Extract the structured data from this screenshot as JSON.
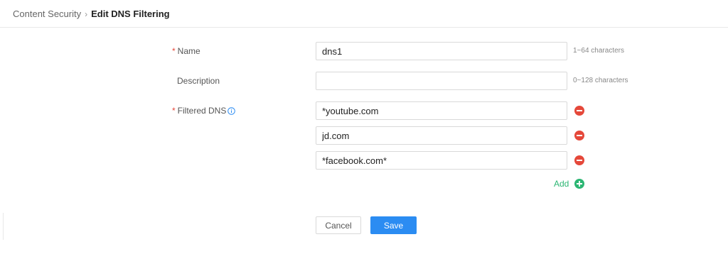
{
  "breadcrumb": {
    "parent": "Content Security",
    "separator": "›",
    "current": "Edit DNS Filtering"
  },
  "form": {
    "name": {
      "label": "Name",
      "required_mark": "*",
      "value": "dns1",
      "hint": "1~64 characters"
    },
    "description": {
      "label": "Description",
      "value": "",
      "hint": "0~128 characters"
    },
    "filtered_dns": {
      "label": "Filtered DNS",
      "required_mark": "*",
      "info_icon": "info-circle-icon",
      "entries": [
        "*youtube.com",
        "jd.com",
        "*facebook.com*"
      ],
      "remove_icon": "remove-circle-icon",
      "add_label": "Add",
      "add_icon": "add-circle-icon"
    }
  },
  "actions": {
    "cancel_label": "Cancel",
    "save_label": "Save"
  },
  "colors": {
    "primary": "#2b8cf2",
    "danger": "#e5483a",
    "success": "#2cb673",
    "required": "#e5483a"
  }
}
